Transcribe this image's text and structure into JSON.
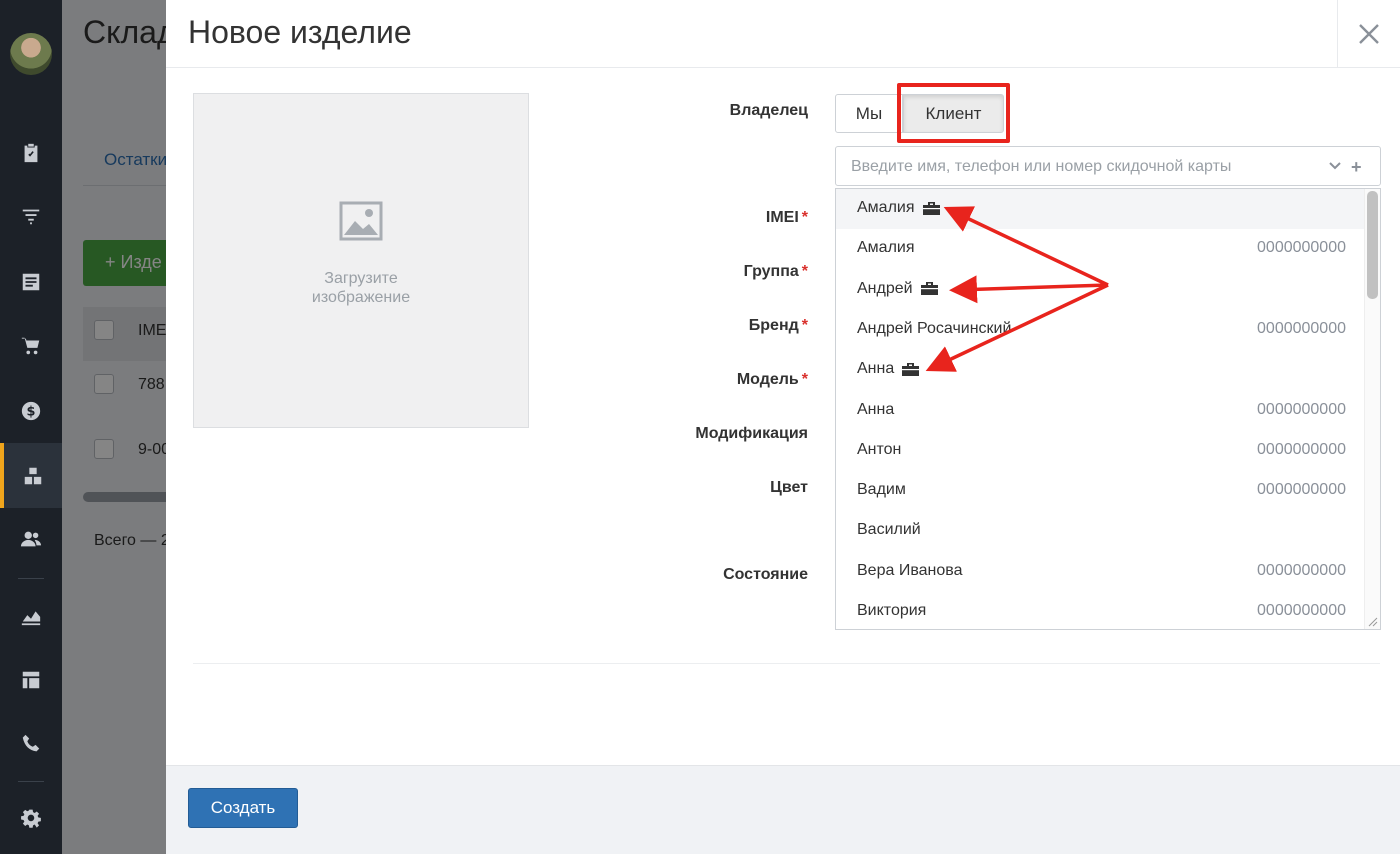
{
  "background_page": {
    "title": "Склад",
    "tab": "Остатки",
    "add_button": "+ Изде",
    "column_header": "IME",
    "rows": [
      "788",
      "9-00"
    ],
    "total": "Всего — 2"
  },
  "modal": {
    "title": "Новое изделие",
    "upload_text": "Загрузите изображение",
    "labels": {
      "owner": "Владелец",
      "imei": "IMEI",
      "group": "Группа",
      "brand": "Бренд",
      "model": "Модель",
      "modification": "Модификация",
      "color": "Цвет",
      "condition": "Состояние"
    },
    "owner_options": [
      "Мы",
      "Клиент"
    ],
    "owner_selected": "Клиент",
    "client_search": {
      "placeholder": "Введите имя, телефон или номер скидочной карты",
      "plus": "+"
    },
    "client_list": [
      {
        "name": "Амалия",
        "phone": "",
        "company": true
      },
      {
        "name": "Амалия",
        "phone": "0000000000",
        "company": false
      },
      {
        "name": "Андрей",
        "phone": "",
        "company": true
      },
      {
        "name": "Андрей Росачинский",
        "phone": "0000000000",
        "company": false
      },
      {
        "name": "Анна",
        "phone": "",
        "company": true
      },
      {
        "name": "Анна",
        "phone": "0000000000",
        "company": false
      },
      {
        "name": "Антон",
        "phone": "0000000000",
        "company": false
      },
      {
        "name": "Вадим",
        "phone": "0000000000",
        "company": false
      },
      {
        "name": "Василий",
        "phone": "",
        "company": false
      },
      {
        "name": "Вера Иванова",
        "phone": "0000000000",
        "company": false
      },
      {
        "name": "Виктория",
        "phone": "0000000000",
        "company": false
      }
    ],
    "create_button": "Создать"
  },
  "colors": {
    "primary": "#2f72b4",
    "annotation": "#e8241d",
    "sidebar": "#1c2128",
    "sidebar_active_accent": "#f0a51c",
    "required": "#d9302c"
  },
  "sidebar_icons": [
    "avatar",
    "clipboard-icon",
    "filter-icon",
    "orders-icon",
    "cart-icon",
    "dollar-icon",
    "warehouse-icon",
    "users-icon",
    "chart-icon",
    "dashboard-icon",
    "phone-icon",
    "gear-icon"
  ]
}
